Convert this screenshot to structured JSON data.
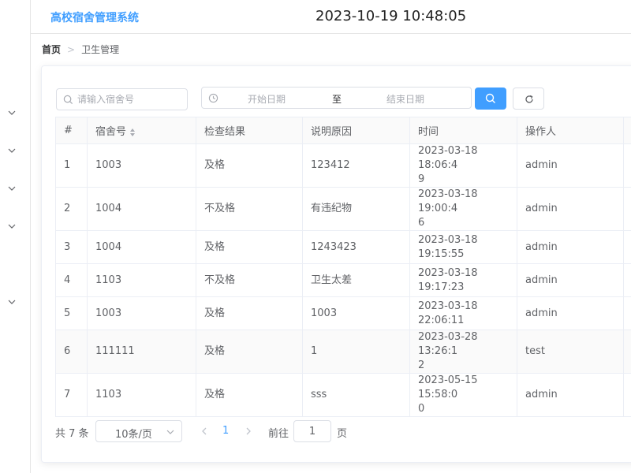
{
  "header": {
    "app_title": "高校宿舍管理系统",
    "datetime": "2023-10-19 10:48:05"
  },
  "breadcrumb": {
    "home": "首页",
    "current": "卫生管理"
  },
  "filters": {
    "search_placeholder": "请输入宿舍号",
    "start_placeholder": "开始日期",
    "range_separator": "至",
    "end_placeholder": "结束日期"
  },
  "table": {
    "columns": [
      "#",
      "宿舍号",
      "检查结果",
      "说明原因",
      "时间",
      "操作人"
    ],
    "rows": [
      {
        "index": "1",
        "room": "1003",
        "result": "及格",
        "reason": "123412",
        "time1": "2023-03-18 18:06:4",
        "time2": "9",
        "operator": "admin"
      },
      {
        "index": "2",
        "room": "1004",
        "result": "不及格",
        "reason": "有违纪物",
        "time1": "2023-03-18 19:00:4",
        "time2": "6",
        "operator": "admin"
      },
      {
        "index": "3",
        "room": "1004",
        "result": "及格",
        "reason": "1243423",
        "time1": "2023-03-18 19:15:55",
        "time2": "",
        "operator": "admin"
      },
      {
        "index": "4",
        "room": "1103",
        "result": "不及格",
        "reason": "卫生太差",
        "time1": "2023-03-18 19:17:23",
        "time2": "",
        "operator": "admin"
      },
      {
        "index": "5",
        "room": "1003",
        "result": "及格",
        "reason": "1003",
        "time1": "2023-03-18 22:06:11",
        "time2": "",
        "operator": "admin"
      },
      {
        "index": "6",
        "room": "111111",
        "result": "及格",
        "reason": "1",
        "time1": "2023-03-28 13:26:1",
        "time2": "2",
        "operator": "test"
      },
      {
        "index": "7",
        "room": "1103",
        "result": "及格",
        "reason": "sss",
        "time1": "2023-05-15 15:58:0",
        "time2": "0",
        "operator": "admin"
      }
    ]
  },
  "pagination": {
    "total": "共 7 条",
    "page_size": "10条/页",
    "current_page": "1",
    "goto_label": "前往",
    "goto_value": "1",
    "page_unit": "页"
  },
  "colors": {
    "accent": "#409eff",
    "border": "#ebeef5"
  }
}
